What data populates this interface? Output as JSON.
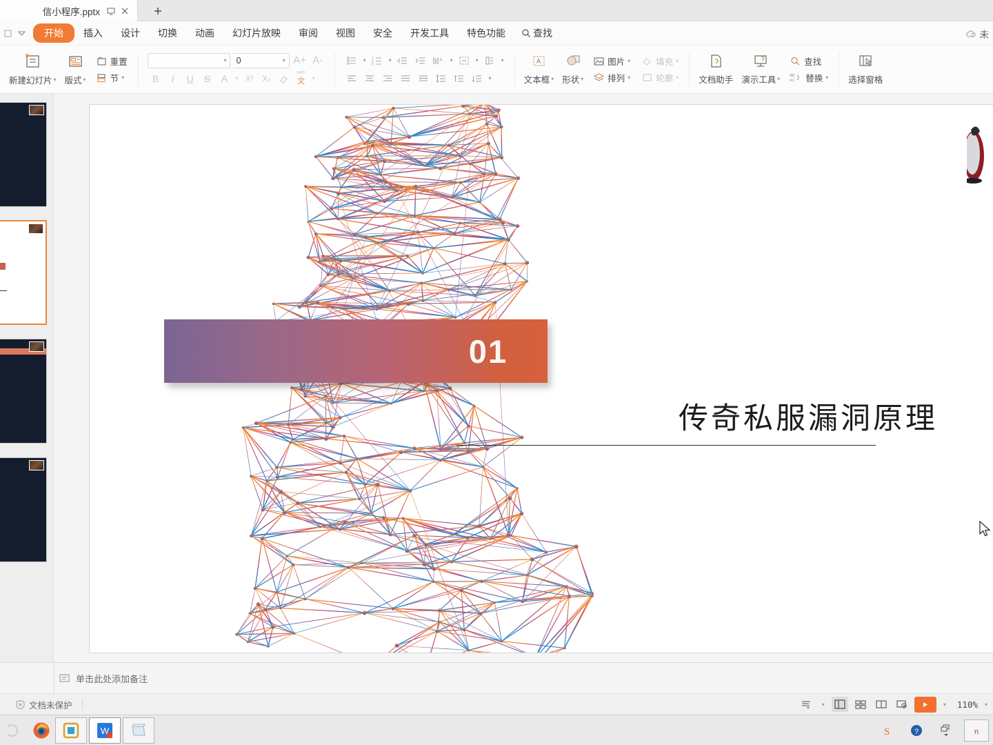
{
  "window": {
    "tab_title": "信小程序.pptx",
    "restore_icon": "restore-window-icon",
    "close_icon": "close-tab-icon",
    "newtab_icon": "new-tab-icon",
    "account_label": "未",
    "cloud_icon": "cloud-icon"
  },
  "menubar": {
    "items": [
      {
        "label": "开始",
        "active": true
      },
      {
        "label": "插入",
        "active": false
      },
      {
        "label": "设计",
        "active": false
      },
      {
        "label": "切换",
        "active": false
      },
      {
        "label": "动画",
        "active": false
      },
      {
        "label": "幻灯片放映",
        "active": false
      },
      {
        "label": "审阅",
        "active": false
      },
      {
        "label": "视图",
        "active": false
      },
      {
        "label": "安全",
        "active": false
      },
      {
        "label": "开发工具",
        "active": false
      },
      {
        "label": "特色功能",
        "active": false
      }
    ],
    "find_label": "查找",
    "find_icon": "search-icon"
  },
  "ribbon": {
    "new_slide": "新建幻灯片",
    "layout": "版式",
    "reset": "重置",
    "section": "节",
    "font_name_value": "",
    "font_size_value": "0",
    "grow_font": "A+",
    "shrink_font": "A-",
    "bold": "B",
    "italic": "I",
    "underline": "U",
    "strikethrough": "S",
    "font_color": "A",
    "superscript": "X²",
    "subscript": "X₂",
    "clear_format": "clear-format-icon",
    "phonetic": "wén",
    "textbox": "文本框",
    "shape": "形状",
    "picture": "图片",
    "arrange": "排列",
    "fill": "填充",
    "outline": "轮廓",
    "doc_assistant": "文档助手",
    "present_tools": "演示工具",
    "find": "查找",
    "replace": "替换",
    "select_pane": "选择窗格"
  },
  "slide": {
    "number_badge": "01",
    "title": "传奇私服漏洞原理",
    "banner_gradient_from": "#7b6593",
    "banner_gradient_to": "#d8603d",
    "background": "#ffffff",
    "mesh_top_color": "#ef8432",
    "mesh_mid_color": "#c4556c",
    "mesh_bottom_color": "#2f7fc0"
  },
  "thumbnails": [
    {
      "index": 1,
      "selected": false,
      "bg": "#141d2e"
    },
    {
      "index": 2,
      "selected": true,
      "bg": "#ffffff"
    },
    {
      "index": 3,
      "selected": false,
      "bg": "#141d2e"
    },
    {
      "index": 4,
      "selected": false,
      "bg": "#141d2e"
    }
  ],
  "notes": {
    "placeholder": "单击此处添加备注",
    "icon": "notes-icon"
  },
  "status": {
    "protection_label": "文档未保护",
    "protection_icon": "shield-x-icon",
    "view_normal_icon": "normal-view-icon",
    "view_sorter_icon": "slide-sorter-icon",
    "view_reading_icon": "reading-view-icon",
    "view_presenter_icon": "presenter-view-icon",
    "play_icon": "play-slideshow-icon",
    "outline_icon": "outline-view-icon",
    "zoom_level": "110%"
  },
  "taskbar": {
    "apps": [
      {
        "name": "firefox-icon",
        "active": false
      },
      {
        "name": "vmware-icon",
        "active": false
      },
      {
        "name": "wps-presentation-icon",
        "active": true
      },
      {
        "name": "notepad-icon",
        "active": false
      }
    ],
    "tray": [
      {
        "name": "sogou-input-icon"
      },
      {
        "name": "help-icon"
      },
      {
        "name": "show-desktop-icon"
      }
    ]
  }
}
